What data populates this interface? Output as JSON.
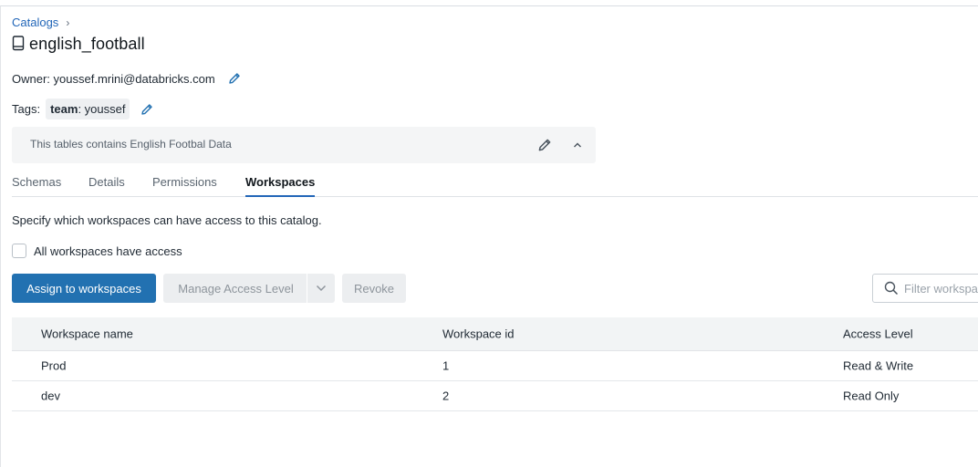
{
  "breadcrumb": {
    "label": "Catalogs",
    "separator": "›"
  },
  "catalog": {
    "name": "english_football",
    "icon": "book-icon"
  },
  "owner": {
    "label": "Owner:",
    "value": "youssef.mrini@databricks.com"
  },
  "tags": {
    "label": "Tags:",
    "items": [
      {
        "key": "team",
        "value": "youssef"
      }
    ]
  },
  "description": {
    "text": "This tables contains English Footbal Data"
  },
  "tabs": [
    {
      "label": "Schemas",
      "active": false
    },
    {
      "label": "Details",
      "active": false
    },
    {
      "label": "Permissions",
      "active": false
    },
    {
      "label": "Workspaces",
      "active": true
    }
  ],
  "workspaces": {
    "intro": "Specify which workspaces can have access to this catalog.",
    "all_access_label": "All workspaces have access",
    "all_access_checked": false,
    "buttons": {
      "assign": "Assign to workspaces",
      "manage": "Manage Access Level",
      "revoke": "Revoke"
    },
    "filter_placeholder": "Filter workspaces"
  },
  "table": {
    "columns": [
      "Workspace name",
      "Workspace id",
      "Access Level"
    ],
    "rows": [
      [
        "Prod",
        "1",
        "Read & Write"
      ],
      [
        "dev",
        "2",
        "Read Only"
      ]
    ]
  },
  "colors": {
    "accent": "#2271b1",
    "link": "#2266b8",
    "disabled_bg": "#eceef0"
  }
}
